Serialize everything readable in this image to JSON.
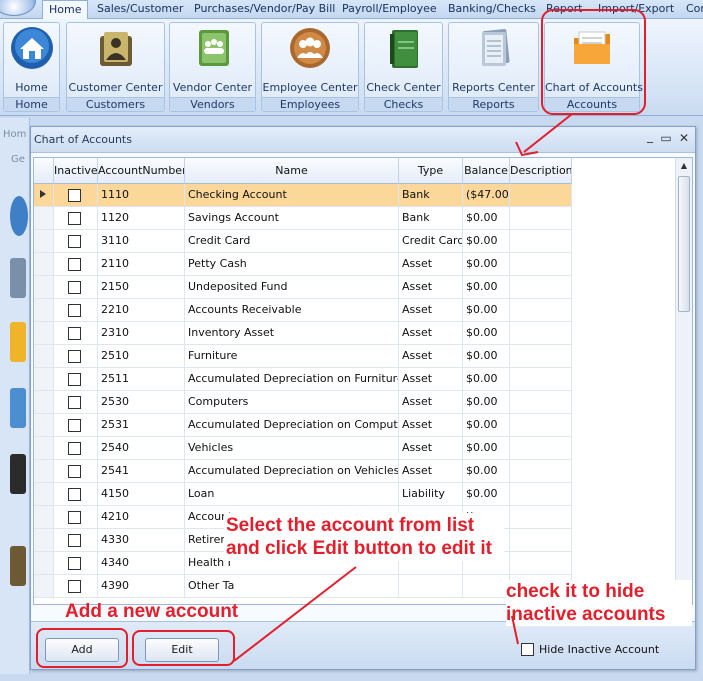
{
  "menu": {
    "tabs": [
      "Home",
      "Sales/Customer",
      "Purchases/Vendor/Pay Bill",
      "Payroll/Employee",
      "Banking/Checks",
      "Report",
      "Import/Export",
      "Cor"
    ],
    "active": "Home"
  },
  "ribbon": {
    "groups": [
      {
        "button": "Home",
        "group": "Home",
        "icon": "home-icon"
      },
      {
        "button": "Customer Center",
        "group": "Customers",
        "icon": "customer-center-icon"
      },
      {
        "button": "Vendor Center",
        "group": "Vendors",
        "icon": "vendor-center-icon"
      },
      {
        "button": "Employee Center",
        "group": "Employees",
        "icon": "employee-center-icon"
      },
      {
        "button": "Check Center",
        "group": "Checks",
        "icon": "check-center-icon"
      },
      {
        "button": "Reports Center",
        "group": "Reports",
        "icon": "reports-center-icon"
      },
      {
        "button": "Chart of Accounts",
        "group": "Accounts",
        "icon": "chart-of-accounts-icon"
      }
    ]
  },
  "background": {
    "home_fragment": "Hom",
    "get_fragment": "Ge"
  },
  "dialog": {
    "title": "Chart of Accounts",
    "columns": [
      "Inactive",
      "AccountNumber",
      "Name",
      "Type",
      "Balance",
      "Description"
    ],
    "rows": [
      {
        "inactive": false,
        "number": "1110",
        "name": "Checking Account",
        "type": "Bank",
        "balance": "($47.00)",
        "description": "",
        "selected": true
      },
      {
        "inactive": false,
        "number": "1120",
        "name": "Savings Account",
        "type": "Bank",
        "balance": "$0.00",
        "description": ""
      },
      {
        "inactive": false,
        "number": "3110",
        "name": "Credit Card",
        "type": "Credit Card",
        "balance": "$0.00",
        "description": ""
      },
      {
        "inactive": false,
        "number": "2110",
        "name": "Petty Cash",
        "type": "Asset",
        "balance": "$0.00",
        "description": ""
      },
      {
        "inactive": false,
        "number": "2150",
        "name": "Undeposited Fund",
        "type": "Asset",
        "balance": "$0.00",
        "description": ""
      },
      {
        "inactive": false,
        "number": "2210",
        "name": "Accounts Receivable",
        "type": "Asset",
        "balance": "$0.00",
        "description": ""
      },
      {
        "inactive": false,
        "number": "2310",
        "name": "Inventory Asset",
        "type": "Asset",
        "balance": "$0.00",
        "description": ""
      },
      {
        "inactive": false,
        "number": "2510",
        "name": "Furniture",
        "type": "Asset",
        "balance": "$0.00",
        "description": ""
      },
      {
        "inactive": false,
        "number": "2511",
        "name": "Accumulated Depreciation on Furniture",
        "type": "Asset",
        "balance": "$0.00",
        "description": ""
      },
      {
        "inactive": false,
        "number": "2530",
        "name": "Computers",
        "type": "Asset",
        "balance": "$0.00",
        "description": ""
      },
      {
        "inactive": false,
        "number": "2531",
        "name": "Accumulated Depreciation on Computers",
        "type": "Asset",
        "balance": "$0.00",
        "description": ""
      },
      {
        "inactive": false,
        "number": "2540",
        "name": "Vehicles",
        "type": "Asset",
        "balance": "$0.00",
        "description": ""
      },
      {
        "inactive": false,
        "number": "2541",
        "name": "Accumulated Depreciation on Vehicles",
        "type": "Asset",
        "balance": "$0.00",
        "description": ""
      },
      {
        "inactive": false,
        "number": "4150",
        "name": "Loan",
        "type": "Liability",
        "balance": "$0.00",
        "description": ""
      },
      {
        "inactive": false,
        "number": "4210",
        "name": "Account",
        "type": "",
        "balance": "))",
        "description": ""
      },
      {
        "inactive": false,
        "number": "4330",
        "name": "Retirem",
        "type": "",
        "balance": "",
        "description": ""
      },
      {
        "inactive": false,
        "number": "4340",
        "name": "Health I",
        "type": "",
        "balance": "",
        "description": ""
      },
      {
        "inactive": false,
        "number": "4390",
        "name": "Other Ta",
        "type": "",
        "balance": "",
        "description": ""
      }
    ],
    "add_label": "Add",
    "edit_label": "Edit",
    "hide_inactive_label": "Hide Inactive Account",
    "hide_inactive_checked": false
  },
  "annotations": {
    "edit_note": "Select the account from list and click Edit button to edit it",
    "add_note": "Add a new account",
    "hide_note": "check it to hide inactive accounts",
    "color": "#e21f2b"
  },
  "colors": {
    "selected_row": "#fcd79a",
    "ribbon": "#d6e4f6",
    "accent": "#e21f2b"
  }
}
